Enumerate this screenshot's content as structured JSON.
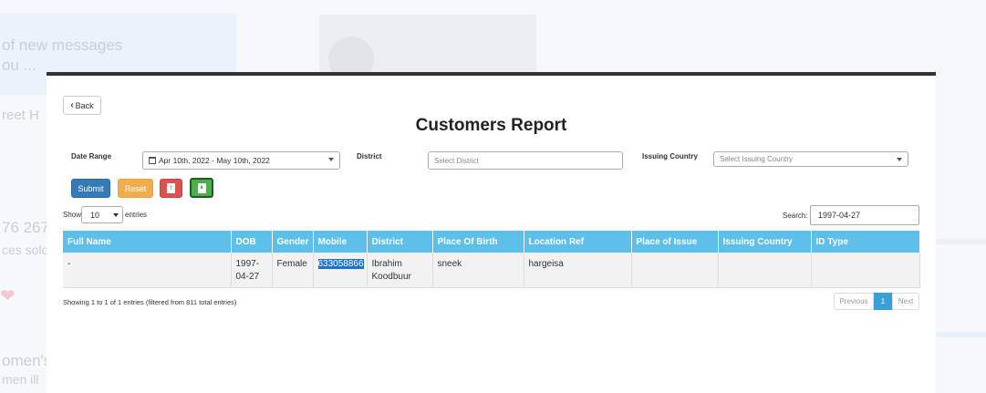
{
  "background": {
    "texts": [
      "of new messages",
      "ou ...",
      "reet H",
      "76 267",
      "ces sold",
      "omen's",
      "men ill"
    ]
  },
  "report": {
    "back_label": "Back",
    "title": "Customers Report",
    "filters": {
      "date_range_label": "Date Range",
      "date_range_value": "Apr 10th, 2022 - May 10th, 2022",
      "district_label": "District",
      "district_placeholder": "Select District",
      "issuing_country_label": "Issuing Country",
      "issuing_country_placeholder": "Select Issuing Country"
    },
    "buttons": {
      "submit": "Submit",
      "reset": "Reset",
      "pdf_icon": "pdf-file-icon",
      "excel_icon": "excel-file-icon"
    },
    "show_label": "Show",
    "entries_value": "10",
    "entries_label": "entries",
    "search_label": "Search:",
    "search_value": "1997-04-27",
    "columns": [
      "Full Name",
      "DOB",
      "Gender",
      "Mobile",
      "District",
      "Place Of Birth",
      "Location Ref",
      "Place of Issue",
      "Issuing Country",
      "ID Type"
    ],
    "rows": [
      {
        "full_name": "-",
        "dob_1": "1997-",
        "dob_2": "04-27",
        "gender": "Female",
        "mobile": "633058866",
        "district_1": "Ibrahim",
        "district_2": "Koodbuur",
        "place_of_birth": "sneek",
        "location_ref": "hargeisa",
        "place_of_issue": "",
        "issuing_country": "",
        "id_type": ""
      }
    ],
    "footer_info": "Showing 1 to 1 of 1 entries (filtered from 811 total entries)",
    "pagination": {
      "previous": "Previous",
      "current": "1",
      "next": "Next"
    }
  },
  "colors": {
    "header_bg": "#5dc0ea",
    "submit": "#337ab7",
    "reset": "#f0ad4e",
    "pdf": "#d9534f",
    "excel": "#4cae4c"
  }
}
